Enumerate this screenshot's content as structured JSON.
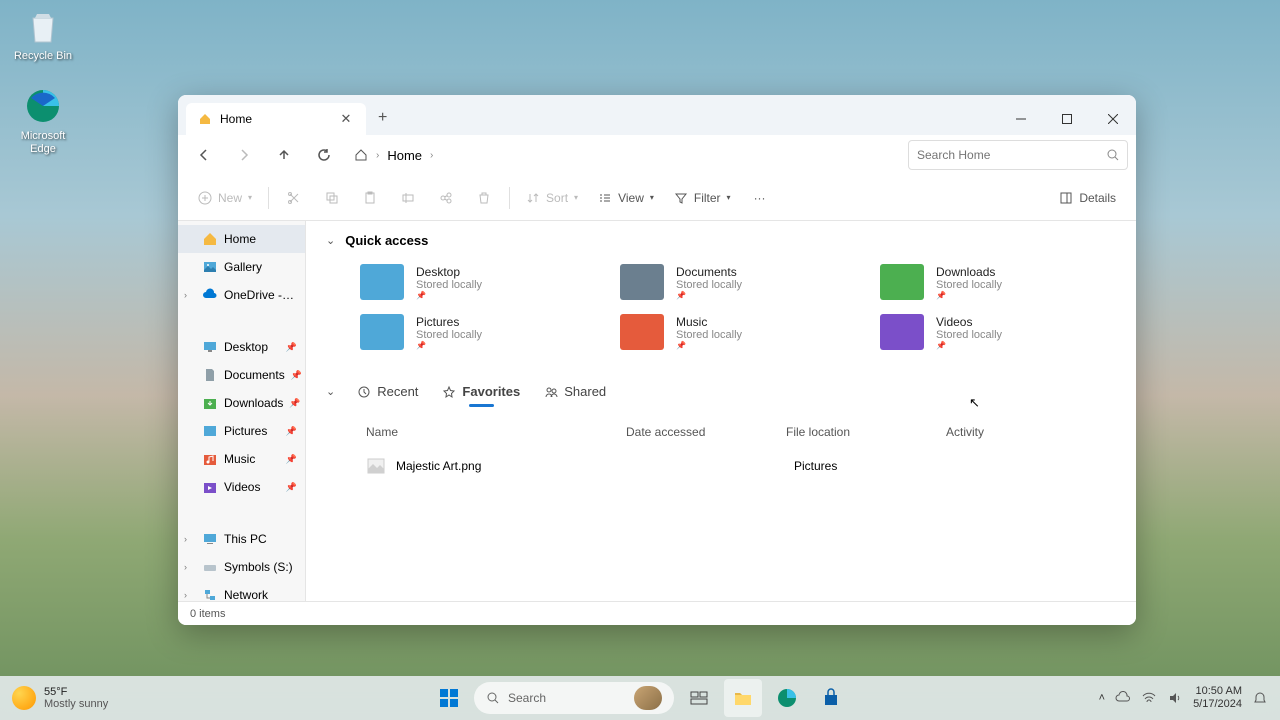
{
  "desktop": {
    "recycle_bin": "Recycle Bin",
    "edge": "Microsoft Edge"
  },
  "window": {
    "tab_title": "Home",
    "breadcrumb": "Home",
    "search_placeholder": "Search Home"
  },
  "toolbar": {
    "new": "New",
    "sort": "Sort",
    "view": "View",
    "filter": "Filter",
    "details": "Details"
  },
  "sidebar": {
    "home": "Home",
    "gallery": "Gallery",
    "onedrive": "OneDrive - Personal",
    "desktop": "Desktop",
    "documents": "Documents",
    "downloads": "Downloads",
    "pictures": "Pictures",
    "music": "Music",
    "videos": "Videos",
    "thispc": "This PC",
    "symbols": "Symbols (S:)",
    "network": "Network"
  },
  "content": {
    "quick_access_title": "Quick access",
    "qa": [
      {
        "name": "Desktop",
        "sub": "Stored locally",
        "color": "#4fa8d8"
      },
      {
        "name": "Documents",
        "sub": "Stored locally",
        "color": "#6b7f8f"
      },
      {
        "name": "Downloads",
        "sub": "Stored locally",
        "color": "#4caf50"
      },
      {
        "name": "Pictures",
        "sub": "Stored locally",
        "color": "#4fa8d8"
      },
      {
        "name": "Music",
        "sub": "Stored locally",
        "color": "#e55b3c"
      },
      {
        "name": "Videos",
        "sub": "Stored locally",
        "color": "#7b4fc9"
      }
    ],
    "tabs": {
      "recent": "Recent",
      "favorites": "Favorites",
      "shared": "Shared"
    },
    "columns": {
      "name": "Name",
      "date": "Date accessed",
      "location": "File location",
      "activity": "Activity"
    },
    "rows": [
      {
        "name": "Majestic Art.png",
        "date": "",
        "location": "Pictures",
        "activity": ""
      }
    ]
  },
  "status": {
    "items": "0 items"
  },
  "taskbar": {
    "temp": "55°F",
    "cond": "Mostly sunny",
    "search": "Search",
    "time": "10:50 AM",
    "date": "5/17/2024"
  }
}
